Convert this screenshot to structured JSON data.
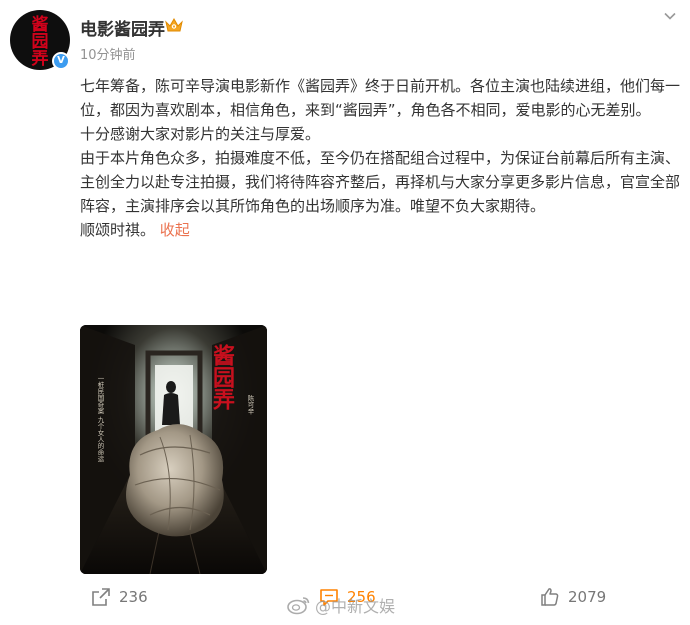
{
  "header": {
    "avatar_text": [
      "酱",
      "园",
      "弄"
    ],
    "user_name": "电影酱园弄",
    "post_time": "10分钟前",
    "badge_icon": "crown-icon",
    "verified_icon": "verified-v-icon"
  },
  "post": {
    "paragraphs": [
      "七年筹备，陈可辛导演电影新作《酱园弄》终于日前开机。各位主演也陆续进组，他们每一位，都因为喜欢剧本，相信角色，来到“酱园弄”，角色各不相同，爱电影的心无差别。",
      "十分感谢大家对影片的关注与厚爱。",
      "由于本片角色众多，拍摄难度不低，至今仍在搭配组合过程中，为保证台前幕后所有主演、主创全力以赴专注拍摄，我们将待阵容齐整后，再择机与大家分享更多影片信息，官宣全部阵容，主演排序会以其所饰角色的出场顺序为准。唯望不负大家期待。"
    ],
    "closing": "顺颂时祺。",
    "collapse_label": "收起",
    "link_color": "#eb7350"
  },
  "poster": {
    "title": "酱园弄",
    "director_line": "陈可辛",
    "side_text": "一桩民国奇案 九个女人的命运"
  },
  "actions": {
    "share_count": "236",
    "comment_count": "256",
    "like_count": "2079",
    "comment_color": "#ff8200"
  },
  "watermark": {
    "text": "@中新文娱"
  }
}
